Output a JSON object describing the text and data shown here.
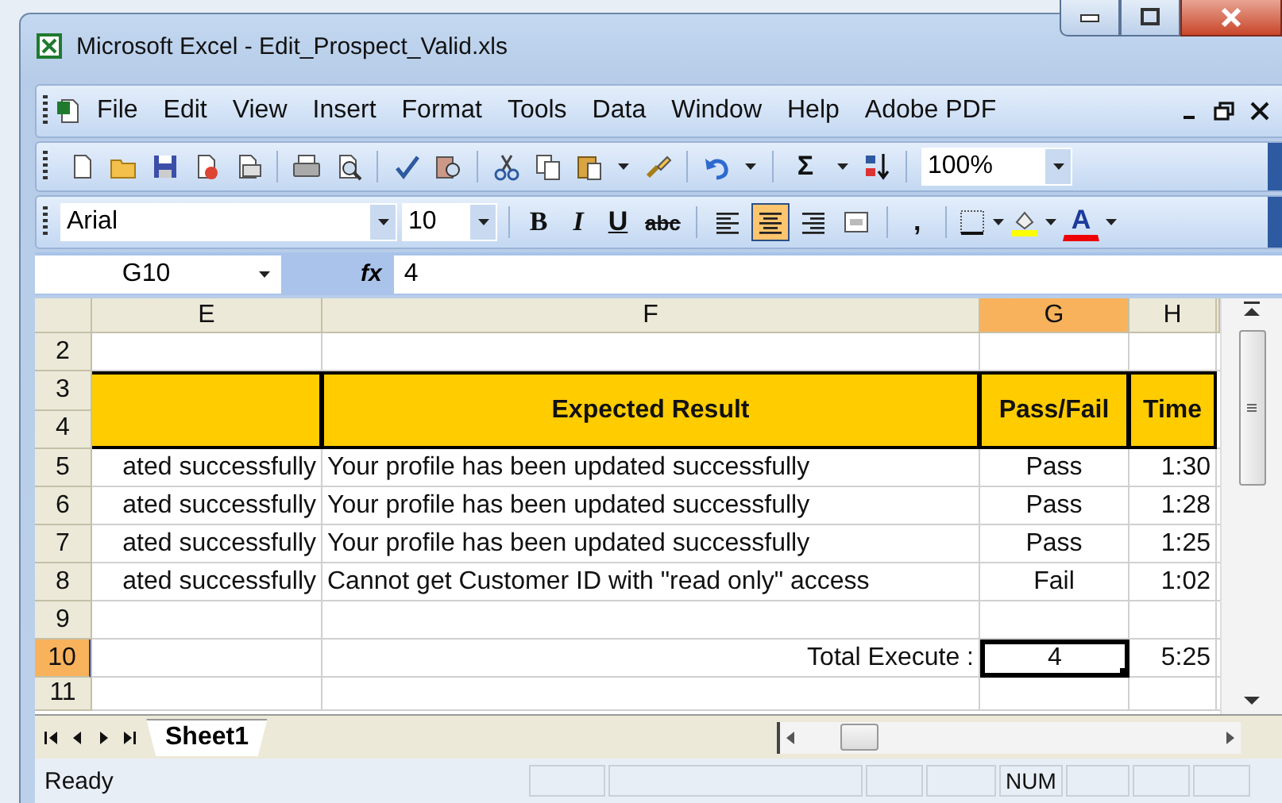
{
  "window": {
    "title": "Microsoft Excel - Edit_Prospect_Valid.xls"
  },
  "menu": [
    "File",
    "Edit",
    "View",
    "Insert",
    "Format",
    "Tools",
    "Data",
    "Window",
    "Help",
    "Adobe PDF"
  ],
  "standard_toolbar": {
    "autosum": "Σ",
    "zoom": "100%"
  },
  "formatting_toolbar": {
    "font": "Arial",
    "size": "10",
    "styles": [
      "B",
      "I",
      "U",
      "abc"
    ],
    "alignment": [
      {
        "selected": false
      },
      {
        "selected": true
      },
      {
        "selected": false
      },
      {
        "selected": false
      }
    ],
    "comma": ",",
    "font_color": "A"
  },
  "formula_bar": {
    "name_box": "G10",
    "fx": "fx",
    "value": "4"
  },
  "sheet": {
    "columns": [
      {
        "label": "E",
        "selected": false
      },
      {
        "label": "F",
        "selected": false
      },
      {
        "label": "G",
        "selected": true
      },
      {
        "label": "H",
        "selected": false
      }
    ],
    "rows": [
      {
        "kind": "blank",
        "numbers": [
          "2"
        ],
        "selected": false,
        "cells": [
          null,
          null,
          null,
          null
        ]
      },
      {
        "kind": "header",
        "numbers": [
          "3",
          "4"
        ],
        "selected": false,
        "cells": [
          null,
          "Expected Result",
          "Pass/Fail",
          "Time"
        ]
      },
      {
        "kind": "data",
        "numbers": [
          "5"
        ],
        "selected": false,
        "cells": [
          "ated successfully",
          "Your profile has been updated successfully",
          "Pass",
          "1:30"
        ]
      },
      {
        "kind": "data",
        "numbers": [
          "6"
        ],
        "selected": false,
        "cells": [
          "ated successfully",
          "Your profile has been updated successfully",
          "Pass",
          "1:28"
        ]
      },
      {
        "kind": "data",
        "numbers": [
          "7"
        ],
        "selected": false,
        "cells": [
          "ated successfully",
          "Your profile has been updated successfully",
          "Pass",
          "1:25"
        ]
      },
      {
        "kind": "data",
        "numbers": [
          "8"
        ],
        "selected": false,
        "cells": [
          "ated successfully",
          "Cannot get Customer ID with \"read only\" access",
          "Fail",
          "1:02"
        ]
      },
      {
        "kind": "blank",
        "numbers": [
          "9"
        ],
        "selected": false,
        "cells": [
          null,
          null,
          null,
          null
        ]
      },
      {
        "kind": "total",
        "numbers": [
          "10"
        ],
        "selected": true,
        "cells": [
          null,
          "Total Execute :",
          "4",
          "5:25"
        ]
      },
      {
        "kind": "blank",
        "numbers": [
          "11"
        ],
        "selected": false,
        "cells": [
          null,
          null,
          null,
          null
        ]
      }
    ]
  },
  "sheet_tabs": [
    {
      "label": "Sheet1",
      "selected": true
    }
  ],
  "status_bar": {
    "text": "Ready",
    "indicators": [
      "NUM"
    ]
  }
}
